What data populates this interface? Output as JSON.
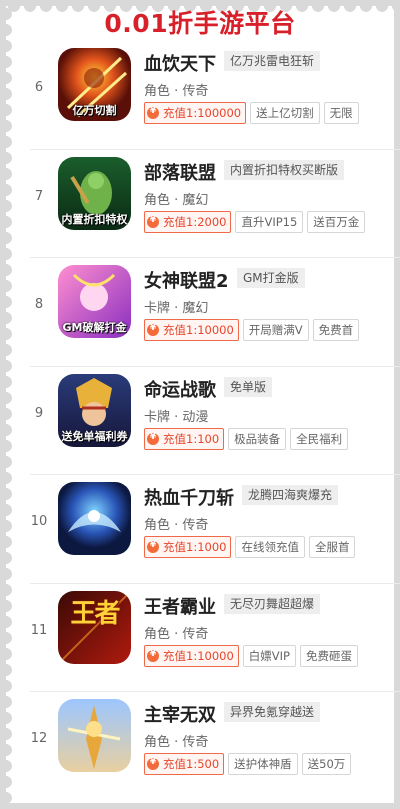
{
  "header": {
    "title": "0.01折手游平台"
  },
  "games": [
    {
      "rank": "6",
      "name": "血饮天下",
      "tag": "亿万兆雷电狂斩",
      "category": "角色",
      "genre": "传奇",
      "recharge": "充值1:100000",
      "chips": [
        "送上亿切割",
        "无限"
      ],
      "icon_name": "game-xueyin-icon",
      "icon_text": "亿万切割"
    },
    {
      "rank": "7",
      "name": "部落联盟",
      "tag": "内置折扣特权买断版",
      "category": "角色",
      "genre": "魔幻",
      "recharge": "充值1:2000",
      "chips": [
        "直升VIP15",
        "送百万金"
      ],
      "icon_name": "game-buluo-icon",
      "icon_text": "内置折扣特权"
    },
    {
      "rank": "8",
      "name": "女神联盟2",
      "tag": "GM打金版",
      "category": "卡牌",
      "genre": "魔幻",
      "recharge": "充值1:10000",
      "chips": [
        "开局赠满V",
        "免费首"
      ],
      "icon_name": "game-nvshen-icon",
      "icon_text": "GM破解打金"
    },
    {
      "rank": "9",
      "name": "命运战歌",
      "tag": "免单版",
      "category": "卡牌",
      "genre": "动漫",
      "recharge": "充值1:100",
      "chips": [
        "极品装备",
        "全民福利"
      ],
      "icon_name": "game-mingyun-icon",
      "icon_text": "送免单福利券"
    },
    {
      "rank": "10",
      "name": "热血千刀斩",
      "tag": "龙腾四海爽爆充",
      "category": "角色",
      "genre": "传奇",
      "recharge": "充值1:1000",
      "chips": [
        "在线领充值",
        "全服首"
      ],
      "icon_name": "game-rexue-icon",
      "icon_text": ""
    },
    {
      "rank": "11",
      "name": "王者霸业",
      "tag": "无尽刃舞超超爆",
      "category": "角色",
      "genre": "传奇",
      "recharge": "充值1:10000",
      "chips": [
        "白嫖VIP",
        "免费砸蛋"
      ],
      "icon_name": "game-wangzhe-icon",
      "icon_text": "王者"
    },
    {
      "rank": "12",
      "name": "主宰无双",
      "tag": "异界免氪穿越送",
      "category": "角色",
      "genre": "传奇",
      "recharge": "充值1:500",
      "chips": [
        "送护体神盾",
        "送50万"
      ],
      "icon_name": "game-zhuzai-icon",
      "icon_text": ""
    }
  ],
  "colors": {
    "accent": "#d8202a",
    "charge": "#e8452c"
  }
}
